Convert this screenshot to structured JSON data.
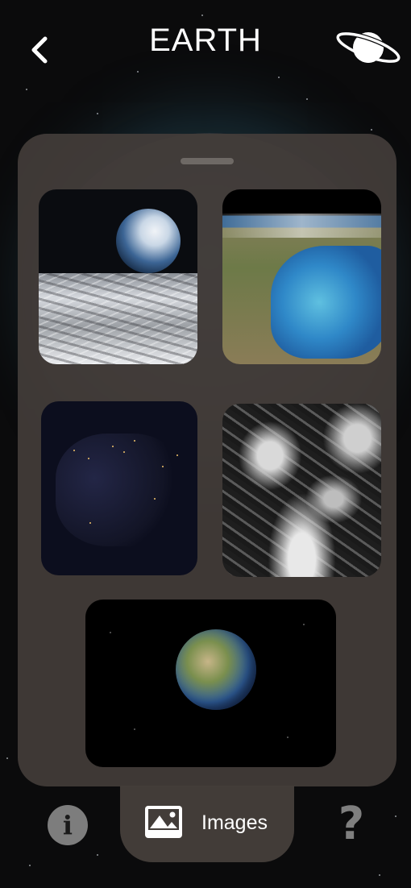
{
  "header": {
    "title": "EARTH",
    "back_icon": "chevron-left-icon",
    "planet_icon": "saturn-icon"
  },
  "gallery": {
    "images": [
      {
        "name": "earthrise-image",
        "subject": "earthrise"
      },
      {
        "name": "satellite-coastline-image",
        "subject": "satellite view"
      },
      {
        "name": "night-lights-image",
        "subject": "night lights"
      },
      {
        "name": "cloud-map-image",
        "subject": "cloud cover"
      },
      {
        "name": "globe-image",
        "subject": "globe"
      }
    ]
  },
  "bottom_nav": {
    "info_icon": "info-icon",
    "images_label": "Images",
    "images_icon": "image-icon",
    "help_icon": "question-mark-icon",
    "info_glyph": "i",
    "help_glyph": "?"
  },
  "colors": {
    "background": "#0b0b0c",
    "panel": "#433d39",
    "icon_gray": "#7d7d7d",
    "text": "#ffffff"
  }
}
